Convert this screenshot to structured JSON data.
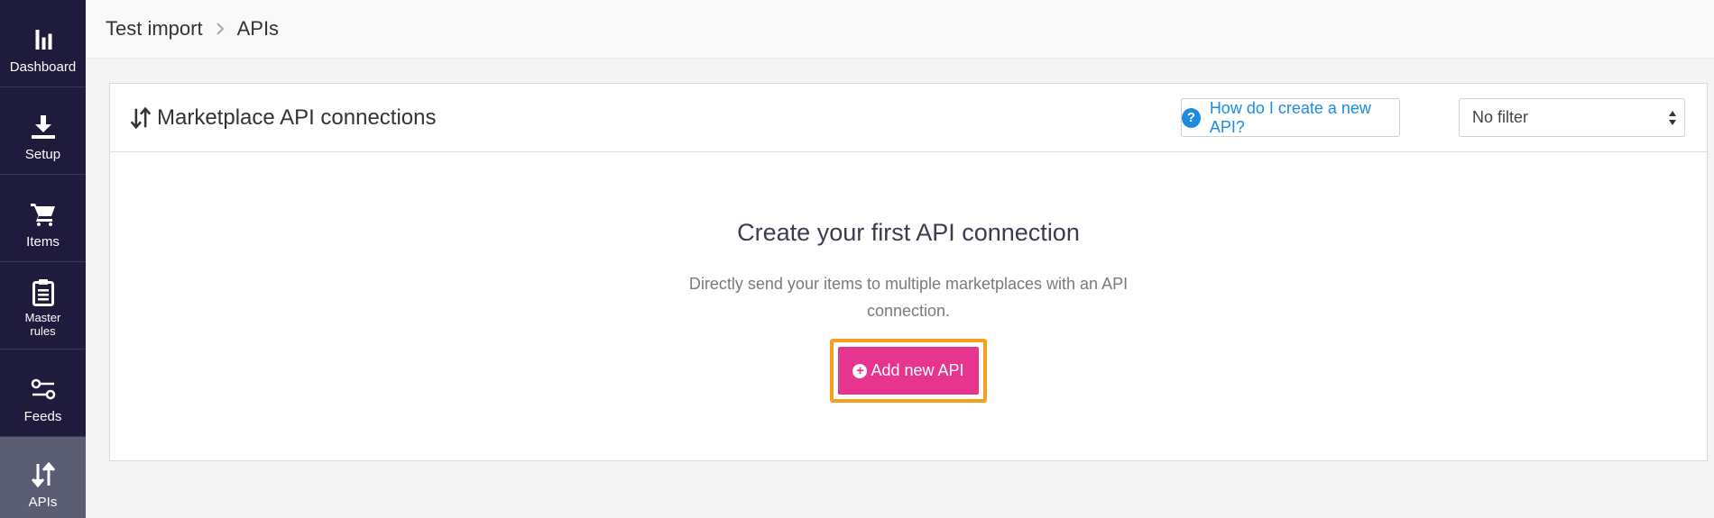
{
  "sidebar": {
    "items": [
      {
        "label": "Dashboard",
        "icon": "bar-chart-icon"
      },
      {
        "label": "Setup",
        "icon": "download-icon"
      },
      {
        "label": "Items",
        "icon": "cart-icon"
      },
      {
        "label": "Master rules",
        "icon": "clipboard-icon"
      },
      {
        "label": "Feeds",
        "icon": "sliders-icon"
      },
      {
        "label": "APIs",
        "icon": "sort-arrows-icon",
        "active": true
      }
    ]
  },
  "breadcrumb": {
    "parent": "Test import",
    "current": "APIs"
  },
  "panel": {
    "title": "Marketplace API connections",
    "help_label": "How do I create a new API?",
    "filter_value": "No filter"
  },
  "empty_state": {
    "title": "Create your first API connection",
    "description": "Directly send your items to multiple marketplaces with an API connection.",
    "button_label": "Add new API"
  },
  "colors": {
    "sidebar_bg": "#1f1b3d",
    "active_item_bg": "#5b5e72",
    "accent_pink": "#e6348f",
    "highlight_orange": "#f7a01d",
    "link_blue": "#1d8ce0"
  }
}
